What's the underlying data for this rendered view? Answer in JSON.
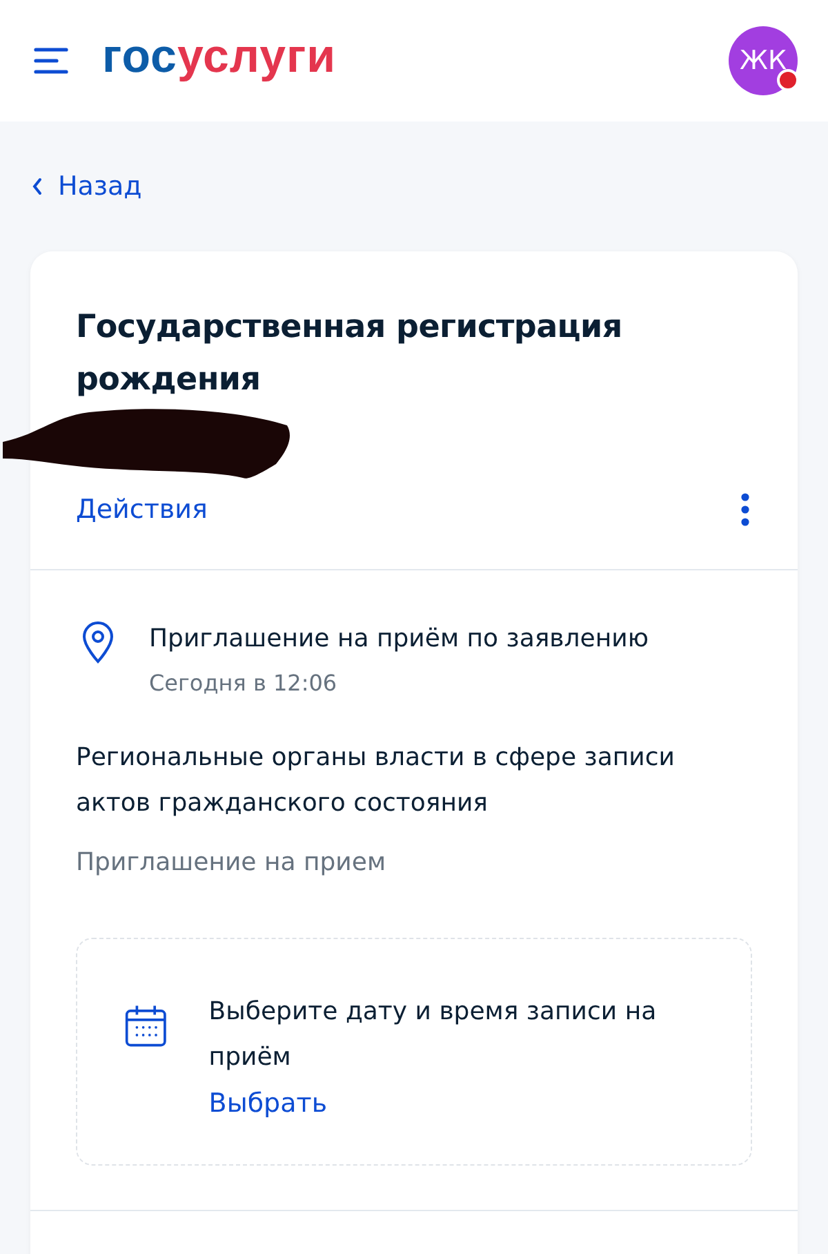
{
  "header": {
    "logo": [
      "гос",
      "услуги"
    ],
    "avatar": {
      "initials": "ЖК",
      "notification": true
    }
  },
  "back_link": "Назад",
  "card": {
    "title": "Государственная регистрация рождения",
    "redacted": true,
    "actions_label": "Действия",
    "event": {
      "title": "Приглашение на приём по заявлению",
      "time": "Сегодня в 12:06"
    },
    "organization": "Региональные органы власти в сфере записи актов гражданского состояния",
    "type": "Приглашение на прием",
    "booking": {
      "text": "Выберите дату и время записи на приём",
      "link": "Выбрать"
    }
  }
}
